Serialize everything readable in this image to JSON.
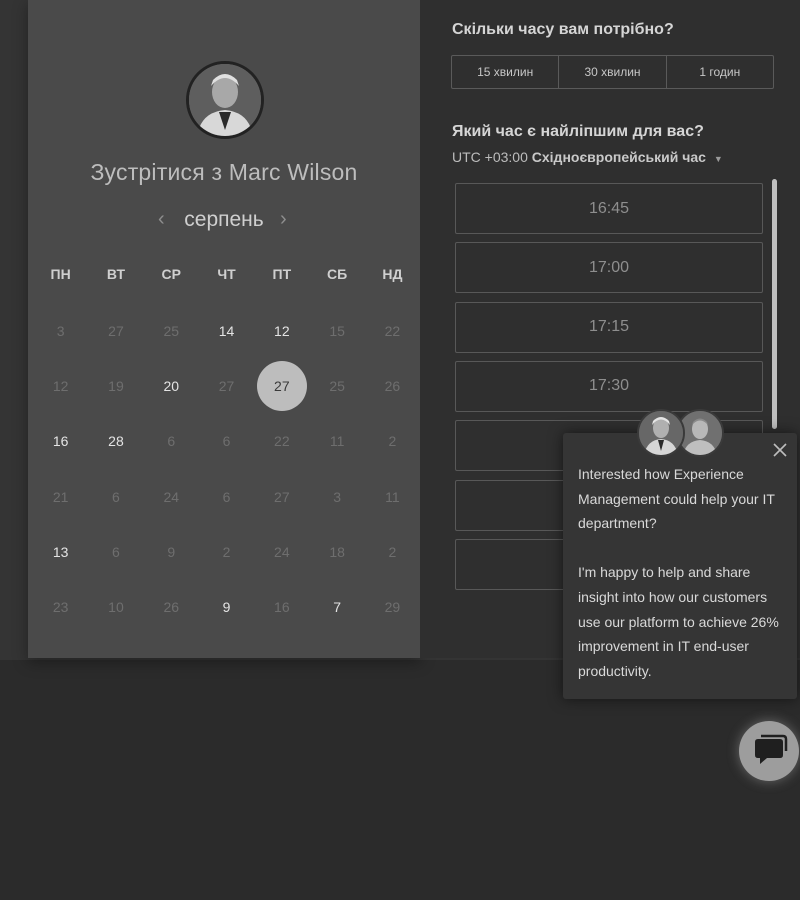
{
  "host": {
    "title": "Зустрітися з Marc Wilson",
    "avatar_icon": "person-portrait"
  },
  "calendar": {
    "month": "серпень",
    "prev_icon": "chevron-left",
    "next_icon": "chevron-right",
    "prev_glyph": "‹",
    "next_glyph": "›",
    "weekdays": [
      "ПН",
      "ВТ",
      "СР",
      "ЧТ",
      "ПТ",
      "СБ",
      "НД"
    ],
    "selected_day": "27",
    "days": [
      {
        "label": "3",
        "available": false
      },
      {
        "label": "27",
        "available": false
      },
      {
        "label": "25",
        "available": false
      },
      {
        "label": "14",
        "available": true
      },
      {
        "label": "12",
        "available": true
      },
      {
        "label": "15",
        "available": false
      },
      {
        "label": "22",
        "available": false
      },
      {
        "label": "12",
        "available": false
      },
      {
        "label": "19",
        "available": false
      },
      {
        "label": "20",
        "available": true
      },
      {
        "label": "27",
        "available": false
      },
      {
        "label": "27",
        "available": true,
        "selected": true
      },
      {
        "label": "25",
        "available": false
      },
      {
        "label": "26",
        "available": false
      },
      {
        "label": "16",
        "available": true
      },
      {
        "label": "28",
        "available": true
      },
      {
        "label": "6",
        "available": false
      },
      {
        "label": "6",
        "available": false
      },
      {
        "label": "22",
        "available": false
      },
      {
        "label": "11",
        "available": false
      },
      {
        "label": "2",
        "available": false
      },
      {
        "label": "21",
        "available": false
      },
      {
        "label": "6",
        "available": false
      },
      {
        "label": "24",
        "available": false
      },
      {
        "label": "6",
        "available": false
      },
      {
        "label": "27",
        "available": false
      },
      {
        "label": "3",
        "available": false
      },
      {
        "label": "11",
        "available": false
      },
      {
        "label": "13",
        "available": true
      },
      {
        "label": "6",
        "available": false
      },
      {
        "label": "9",
        "available": false
      },
      {
        "label": "2",
        "available": false
      },
      {
        "label": "24",
        "available": false
      },
      {
        "label": "18",
        "available": false
      },
      {
        "label": "2",
        "available": false
      },
      {
        "label": "23",
        "available": false
      },
      {
        "label": "10",
        "available": false
      },
      {
        "label": "26",
        "available": false
      },
      {
        "label": "9",
        "available": true
      },
      {
        "label": "16",
        "available": false
      },
      {
        "label": "7",
        "available": true
      },
      {
        "label": "29",
        "available": false
      }
    ]
  },
  "duration": {
    "question": "Скільки часу вам потрібно?",
    "options": [
      "15 хвилин",
      "30 хвилин",
      "1 годин"
    ]
  },
  "time": {
    "question": "Який час є найліпшим для вас?",
    "timezone_offset": "UTC +03:00",
    "timezone_name": "Східноєвропейський час",
    "slots": [
      "16:45",
      "17:00",
      "17:15",
      "17:30",
      "",
      "",
      ""
    ]
  },
  "chat": {
    "paragraph1": "Interested how Experience Management could help your IT department?",
    "paragraph2": "I'm happy to help and share insight into how our customers use our platform to achieve 26% improvement in IT end-user productivity.",
    "close_icon": "close-x",
    "launcher_icon": "chat-bubble"
  }
}
